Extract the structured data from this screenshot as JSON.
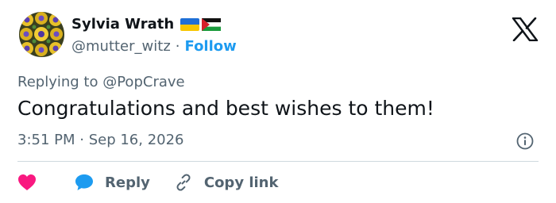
{
  "author": {
    "display_name": "Sylvia Wrath",
    "handle": "@mutter_witz",
    "separator": "·",
    "follow_label": "Follow",
    "avatar_icon": "sunflower-pattern-avatar",
    "flags": [
      "ukraine-flag-icon",
      "palestine-flag-icon"
    ]
  },
  "header": {
    "logo_icon": "x-logo-icon"
  },
  "reply_context": {
    "prefix": "Replying to",
    "mention": "@PopCrave"
  },
  "tweet": {
    "text": "Congratulations and best wishes to them!",
    "timestamp": "3:51 PM · Sep 16, 2026",
    "info_icon": "info-icon"
  },
  "actions": {
    "like_icon": "heart-icon",
    "reply_icon": "speech-bubble-icon",
    "reply_label": "Reply",
    "copy_icon": "link-icon",
    "copy_label": "Copy link"
  },
  "colors": {
    "accent": "#1d9bf0",
    "like": "#f91880",
    "secondary_text": "#536471",
    "primary_text": "#0f1419",
    "divider": "#cfd9de"
  }
}
